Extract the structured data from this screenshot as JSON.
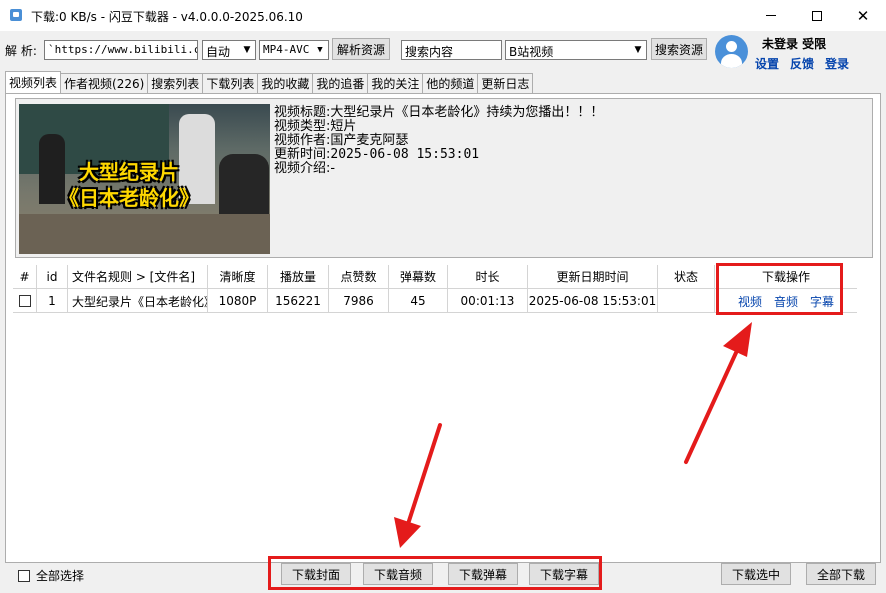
{
  "window": {
    "title": "下载:0 KB/s - 闪豆下载器 - v4.0.0.0-2025.06.10",
    "minimize": "minimize",
    "maximize": "maximize",
    "close": "✕"
  },
  "toolbar": {
    "parse_label": "解 析:",
    "url_value": "`https://www.bilibili.co",
    "quality_value": "自动",
    "codec_value": "MP4-AVC",
    "parse_button": "解析资源",
    "search_input_value": "搜索内容",
    "search_source_value": "B站视频",
    "search_button": "搜索资源"
  },
  "user": {
    "status": "未登录 受限",
    "settings": "设置",
    "feedback": "反馈",
    "login": "登录"
  },
  "tabs": [
    {
      "label": "视频列表",
      "active": true
    },
    {
      "label": "作者视频(226)"
    },
    {
      "label": "搜索列表"
    },
    {
      "label": "下载列表"
    },
    {
      "label": "我的收藏"
    },
    {
      "label": "我的追番"
    },
    {
      "label": "我的关注"
    },
    {
      "label": "他的频道"
    },
    {
      "label": "更新日志"
    }
  ],
  "video_info": {
    "thumb_line1": "大型纪录片",
    "thumb_line2": "《日本老龄化》",
    "title_key": "视频标题:",
    "title_val": "大型纪录片《日本老龄化》持续为您播出！！！",
    "type_key": "视频类型:",
    "type_val": "短片",
    "author_key": "视频作者:",
    "author_val": "国产麦克阿瑟",
    "updated_key": "更新时间:",
    "updated_val": "2025-06-08 15:53:01",
    "intro_key": "视频介绍:",
    "intro_val": "-"
  },
  "table": {
    "headers": [
      "#",
      "id",
      "文件名规则  >  [文件名]",
      "清晰度",
      "播放量",
      "点赞数",
      "弹幕数",
      "时长",
      "更新日期时间",
      "状态",
      "下载操作"
    ],
    "rows": [
      {
        "id": "1",
        "filename": "大型纪录片《日本老龄化》",
        "quality": "1080P",
        "views": "156221",
        "likes": "7986",
        "danmaku": "45",
        "duration": "00:01:13",
        "updated": "2025-06-08 15:53:01",
        "status": "",
        "actions": [
          "视频",
          "音频",
          "字幕"
        ]
      }
    ]
  },
  "bottom": {
    "select_all": "全部选择",
    "download_cover": "下载封面",
    "download_audio": "下载音频",
    "download_danmaku": "下载弹幕",
    "download_subtitle": "下载字幕",
    "download_selected": "下载选中",
    "download_all": "全部下载"
  },
  "colors": {
    "annotation_red": "#e41b1b",
    "link_blue": "#0645ad"
  }
}
